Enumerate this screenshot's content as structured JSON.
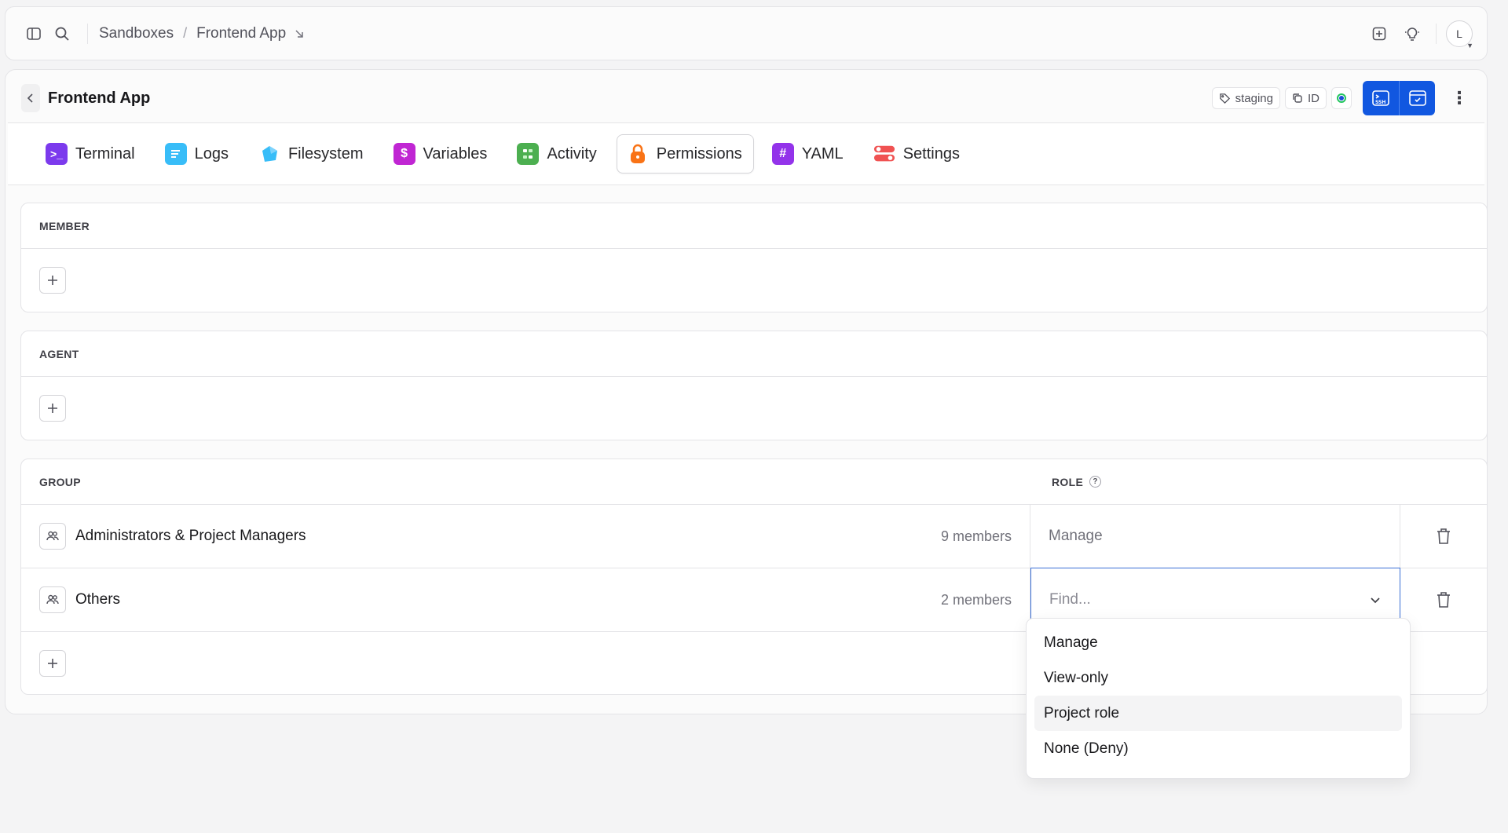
{
  "breadcrumb": {
    "root": "Sandboxes",
    "separator": "/",
    "current": "Frontend App"
  },
  "user": {
    "avatar_initial": "L"
  },
  "page": {
    "title": "Frontend App",
    "env_tag": "staging",
    "id_label": "ID"
  },
  "tabs": [
    {
      "label": "Terminal",
      "icon": "terminal-icon",
      "color": "#7c3aed"
    },
    {
      "label": "Logs",
      "icon": "logs-icon",
      "color": "#38bdf8"
    },
    {
      "label": "Filesystem",
      "icon": "filesystem-icon",
      "color": "#38bdf8"
    },
    {
      "label": "Variables",
      "icon": "dollar-icon",
      "color": "#c026d3"
    },
    {
      "label": "Activity",
      "icon": "activity-icon",
      "color": "#4caf50"
    },
    {
      "label": "Permissions",
      "icon": "lock-icon",
      "color": "#f97316"
    },
    {
      "label": "YAML",
      "icon": "hash-icon",
      "color": "#9333ea"
    },
    {
      "label": "Settings",
      "icon": "toggles-icon",
      "color": "#f05252"
    }
  ],
  "active_tab": "Permissions",
  "sections": {
    "member": {
      "title": "MEMBER"
    },
    "agent": {
      "title": "AGENT"
    },
    "group": {
      "title": "GROUP",
      "role_title": "ROLE",
      "role_help": "?",
      "rows": [
        {
          "name": "Administrators & Project Managers",
          "count": "9 members",
          "role": "Manage"
        },
        {
          "name": "Others",
          "count": "2 members",
          "role": ""
        }
      ],
      "role_placeholder": "Find..."
    }
  },
  "role_options": [
    "Manage",
    "View-only",
    "Project role",
    "None (Deny)"
  ],
  "highlighted_option": "Project role"
}
